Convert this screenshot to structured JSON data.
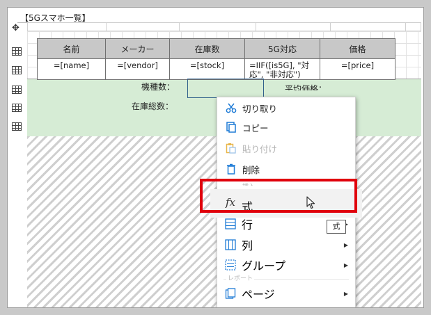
{
  "report": {
    "title": "【5Gスマホ一覧】",
    "headers": [
      "名前",
      "メーカー",
      "在庫数",
      "5G対応",
      "価格"
    ],
    "fields": [
      "=[name]",
      "=[vendor]",
      "=[stock]",
      "=IIF([is5G], \"対応\", \"非対応\")",
      "=[price]"
    ]
  },
  "summary": {
    "count_label": "機種数：",
    "stock_label": "在庫総数：",
    "avg_price_label": "平均価格："
  },
  "context_menu": {
    "items": {
      "cut": "切り取り",
      "copy": "コピー",
      "paste": "貼り付け",
      "delete": "削除",
      "formula": "式",
      "row": "行",
      "column": "列",
      "group": "グループ",
      "page": "ページ"
    },
    "sections": {
      "insert": "挿入",
      "report": "レポート"
    },
    "formula_icon": "fx"
  },
  "tooltip": "式",
  "colors": {
    "highlight": "#e0000c",
    "detail_band": "#d6ecd5",
    "header_cell": "#c8c8c8",
    "menu_icon": "#1e7bd6"
  }
}
